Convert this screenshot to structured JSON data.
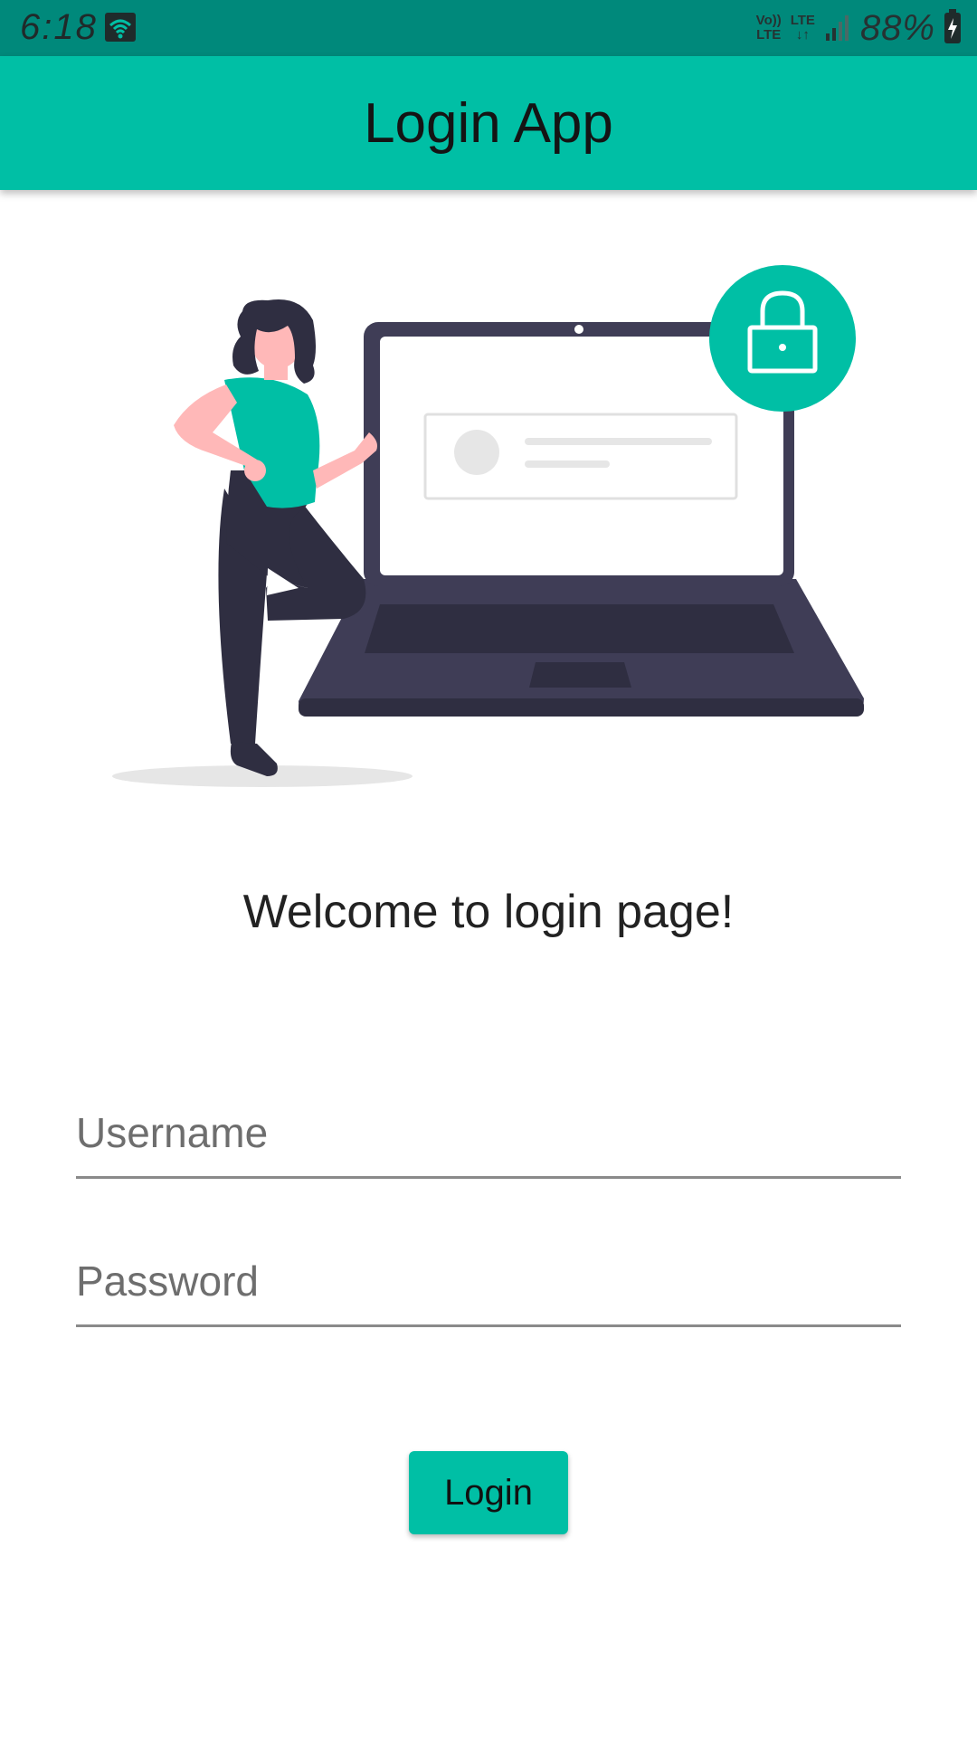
{
  "status_bar": {
    "time": "6:18",
    "volte_line1": "Vo))",
    "volte_line2": "LTE",
    "lte_label": "LTE",
    "battery": "88%",
    "icons": [
      "wifi-icon",
      "signal-icon",
      "battery-charging-icon"
    ]
  },
  "app_bar": {
    "title": "Login App"
  },
  "illustration": {
    "description_icons": [
      "woman-figure",
      "laptop-icon",
      "lock-icon"
    ],
    "accent": "#00bfa5",
    "dark": "#3f3d56"
  },
  "welcome": {
    "text": "Welcome to login page!"
  },
  "form": {
    "username_placeholder": "Username",
    "password_placeholder": "Password",
    "login_label": "Login"
  },
  "colors": {
    "status_bar": "#00897b",
    "primary": "#00bfa5",
    "text": "#222222"
  }
}
